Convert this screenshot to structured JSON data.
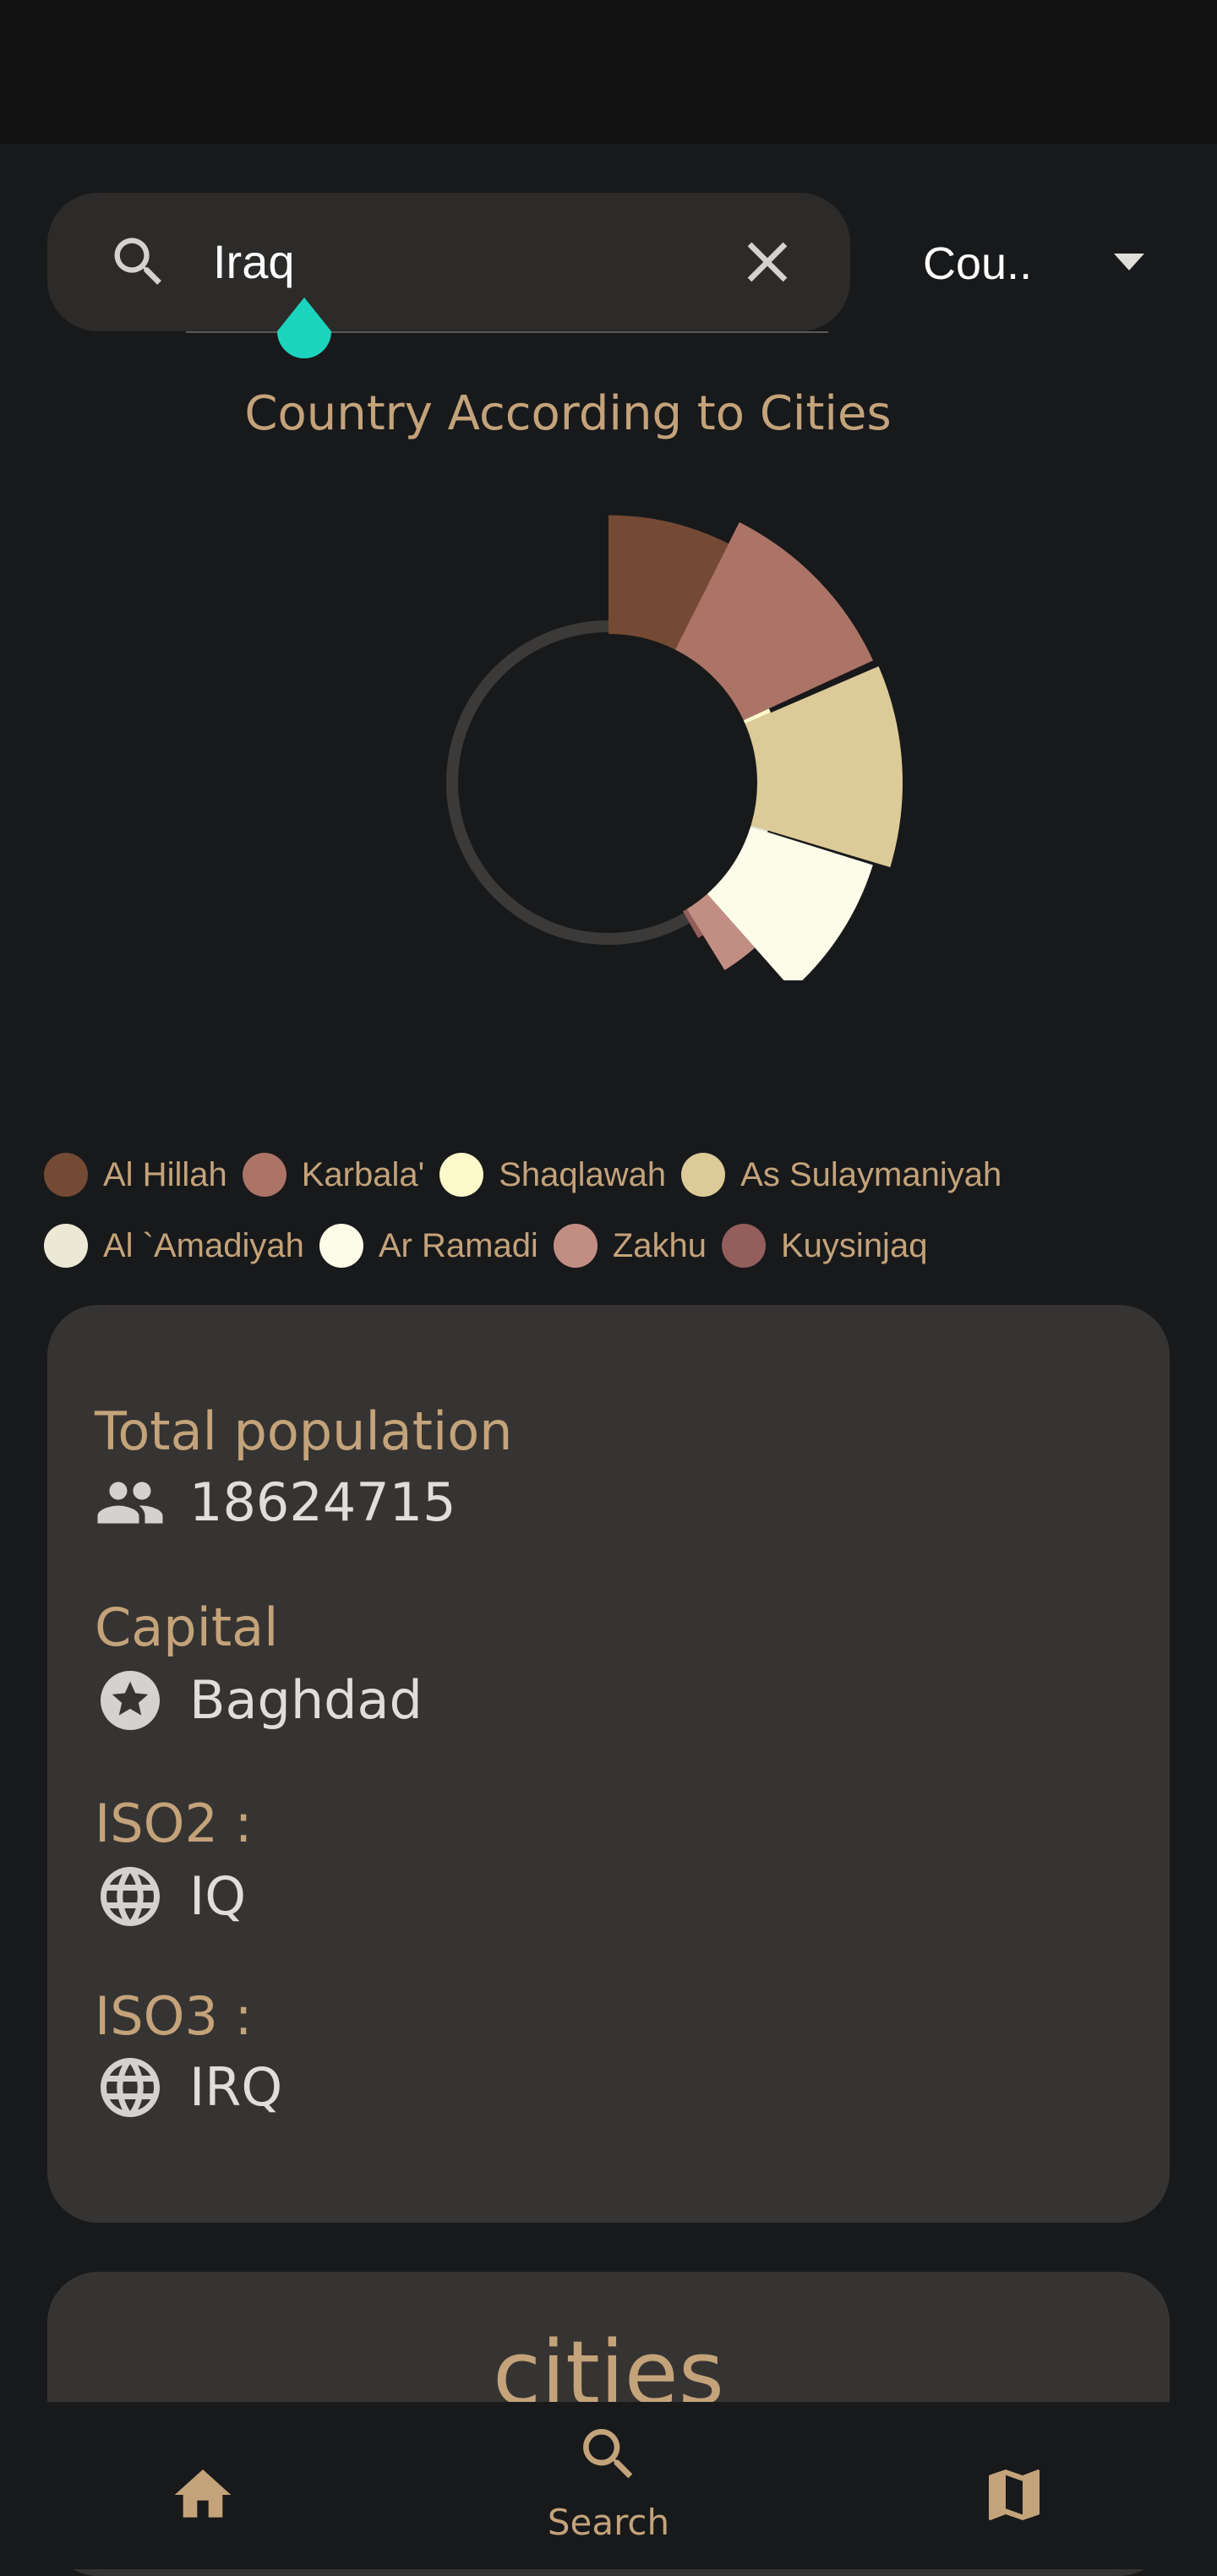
{
  "search": {
    "value": "Iraq"
  },
  "filter": {
    "selected": "Cou.."
  },
  "chart_data": {
    "type": "pie",
    "title": "Country According to Cities",
    "slices": [
      {
        "label": "Al Hillah",
        "value": 9.0,
        "color": "#744a34"
      },
      {
        "label": "Karbala'",
        "value": 13.0,
        "color": "#ac7466"
      },
      {
        "label": "Shaqlawah",
        "value": 0.5,
        "color": "#fdf9cb"
      },
      {
        "label": "As Sulaymaniyah",
        "value": 13.5,
        "color": "#dccb98"
      },
      {
        "label": "Al `Amadiyah",
        "value": 0.2,
        "color": "#ece8d6"
      },
      {
        "label": "Ar Ramadi",
        "value": 10.5,
        "color": "#fdfce8"
      },
      {
        "label": "Zakhu",
        "value": 3.3,
        "color": "#c28e84"
      },
      {
        "label": "Kuysinjaq",
        "value": 0.6,
        "color": "#935e5b"
      }
    ]
  },
  "stats": {
    "population_label": "Total population",
    "population_value": "18624715",
    "capital_label": "Capital",
    "capital_value": "Baghdad",
    "iso2_label": "ISO2 :",
    "iso2_value": "IQ",
    "iso3_label": "ISO3 :",
    "iso3_value": "IRQ"
  },
  "cities": {
    "title": "cities"
  },
  "nav": {
    "search_label": "Search"
  },
  "colors": {
    "accent": "#c4a37a",
    "background": "#18191b",
    "card": "#363432",
    "caret": "#1cd4be"
  },
  "icons": [
    "search-icon",
    "close-icon",
    "dropdown-arrow-icon",
    "people-icon",
    "star-icon",
    "globe-icon",
    "home-icon",
    "map-icon"
  ]
}
